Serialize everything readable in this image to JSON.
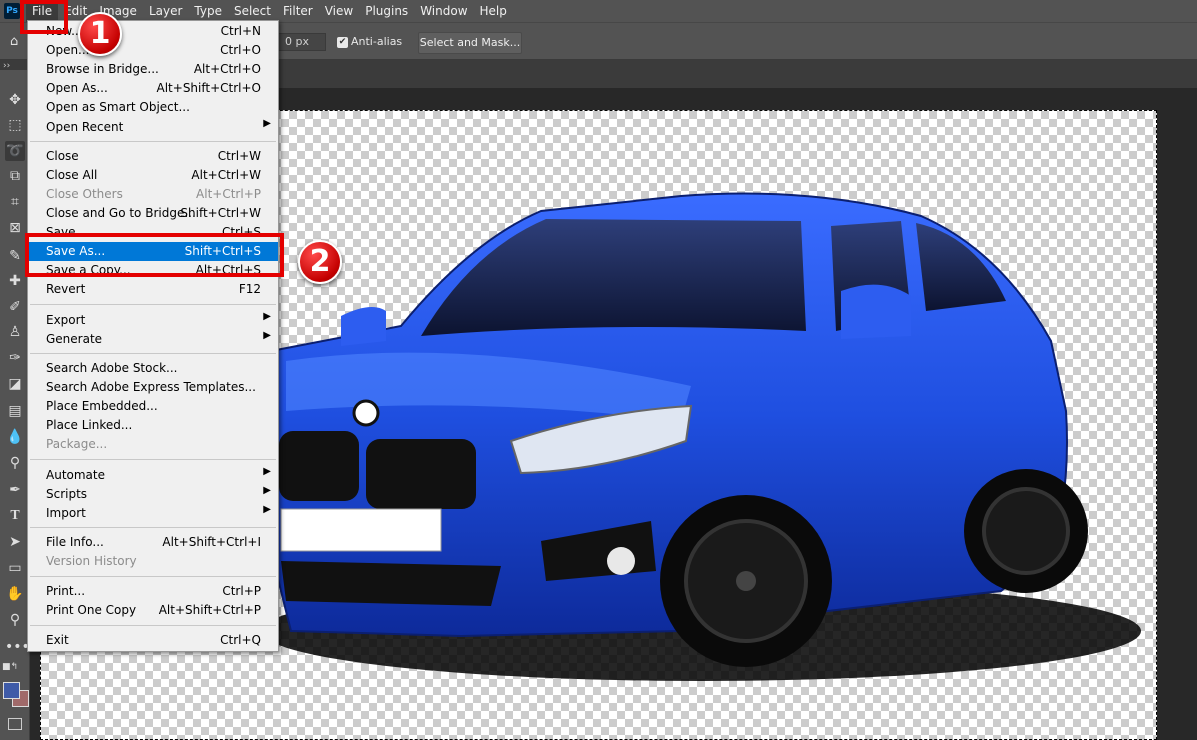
{
  "app": {
    "logo": "Ps"
  },
  "menubar": {
    "items": [
      "File",
      "Edit",
      "Image",
      "Layer",
      "Type",
      "Select",
      "Filter",
      "View",
      "Plugins",
      "Window",
      "Help"
    ]
  },
  "options": {
    "feather_value": "0 px",
    "anti_alias_label": "Anti-alias",
    "select_mask_label": "Select and Mask..."
  },
  "tools": [
    "move-icon",
    "marquee-icon",
    "lasso-icon",
    "object-select-icon",
    "crop-icon",
    "frame-icon",
    "eyedropper-icon",
    "healing-icon",
    "brush-icon",
    "stamp-icon",
    "history-brush-icon",
    "eraser-icon",
    "gradient-icon",
    "blur-icon",
    "dodge-icon",
    "pen-icon",
    "type-icon",
    "path-select-icon",
    "rectangle-icon",
    "hand-icon",
    "zoom-icon",
    "more-icon"
  ],
  "colors": {
    "foreground": "#3f5ba8",
    "background": "#a06a6a",
    "highlight": "#0078d7",
    "annotation": "#e40000"
  },
  "file_menu": {
    "items": [
      {
        "label": "New...",
        "shortcut": "Ctrl+N"
      },
      {
        "label": "Open...",
        "shortcut": "Ctrl+O"
      },
      {
        "label": "Browse in Bridge...",
        "shortcut": "Alt+Ctrl+O"
      },
      {
        "label": "Open As...",
        "shortcut": "Alt+Shift+Ctrl+O"
      },
      {
        "label": "Open as Smart Object...",
        "shortcut": ""
      },
      {
        "label": "Open Recent",
        "shortcut": ""
      },
      {
        "label": "Close",
        "shortcut": "Ctrl+W"
      },
      {
        "label": "Close All",
        "shortcut": "Alt+Ctrl+W"
      },
      {
        "label": "Close Others",
        "shortcut": "Alt+Ctrl+P"
      },
      {
        "label": "Close and Go to Bridge...",
        "shortcut": "Shift+Ctrl+W"
      },
      {
        "label": "Save",
        "shortcut": "Ctrl+S"
      },
      {
        "label": "Save As...",
        "shortcut": "Shift+Ctrl+S"
      },
      {
        "label": "Save a Copy...",
        "shortcut": "Alt+Ctrl+S"
      },
      {
        "label": "Revert",
        "shortcut": "F12"
      },
      {
        "label": "Export",
        "shortcut": ""
      },
      {
        "label": "Generate",
        "shortcut": ""
      },
      {
        "label": "Search Adobe Stock...",
        "shortcut": ""
      },
      {
        "label": "Search Adobe Express Templates...",
        "shortcut": ""
      },
      {
        "label": "Place Embedded...",
        "shortcut": ""
      },
      {
        "label": "Place Linked...",
        "shortcut": ""
      },
      {
        "label": "Package...",
        "shortcut": ""
      },
      {
        "label": "Automate",
        "shortcut": ""
      },
      {
        "label": "Scripts",
        "shortcut": ""
      },
      {
        "label": "Import",
        "shortcut": ""
      },
      {
        "label": "File Info...",
        "shortcut": "Alt+Shift+Ctrl+I"
      },
      {
        "label": "Version History",
        "shortcut": ""
      },
      {
        "label": "Print...",
        "shortcut": "Ctrl+P"
      },
      {
        "label": "Print One Copy",
        "shortcut": "Alt+Shift+Ctrl+P"
      },
      {
        "label": "Exit",
        "shortcut": "Ctrl+Q"
      }
    ]
  },
  "annotations": {
    "step1": "1",
    "step2": "2"
  },
  "car": {
    "plate": ""
  }
}
